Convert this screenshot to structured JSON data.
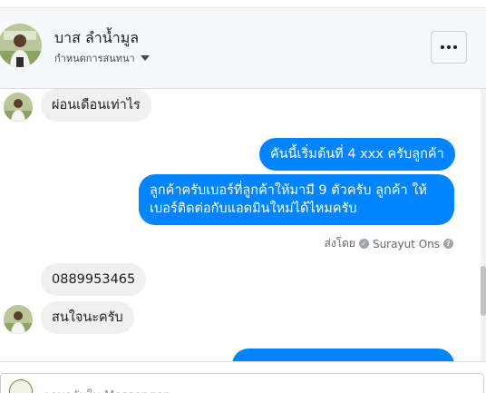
{
  "header": {
    "contact_name": "บาส ลำน้ำมูล",
    "status_label": "กำหนดการสนทนา",
    "more_icon": "more-horizontal-icon"
  },
  "messages": [
    {
      "direction": "incoming",
      "text": "ผ่อนเดือนเท่าไร"
    },
    {
      "direction": "outgoing",
      "text": "คันนี้เริ่มต้นที่ 4 xxx ครับลูกค้า"
    },
    {
      "direction": "outgoing",
      "text": "ลูกค้าครับเบอร์ที่ลูกค้าให้มามี 9 ตัวครับ ลูกค้า ให้เบอร์ติดต่อกับแอดมินใหม่ได้ไหมครับ"
    },
    {
      "direction": "incoming",
      "text": "0889953465"
    },
    {
      "direction": "incoming",
      "text": "สนใจนะครับ"
    }
  ],
  "sent_by": {
    "prefix": "ส่งโดย",
    "name": "Surayut Ons",
    "check_icon": "check-circle-icon",
    "help_icon": "help-circle-icon"
  },
  "reply": {
    "placeholder": "ตอบกลับใน Messenger"
  },
  "colors": {
    "outgoing_bubble": "#0084ff",
    "incoming_bubble": "#f1f0f0",
    "header_bg": "#f7f8fa"
  }
}
